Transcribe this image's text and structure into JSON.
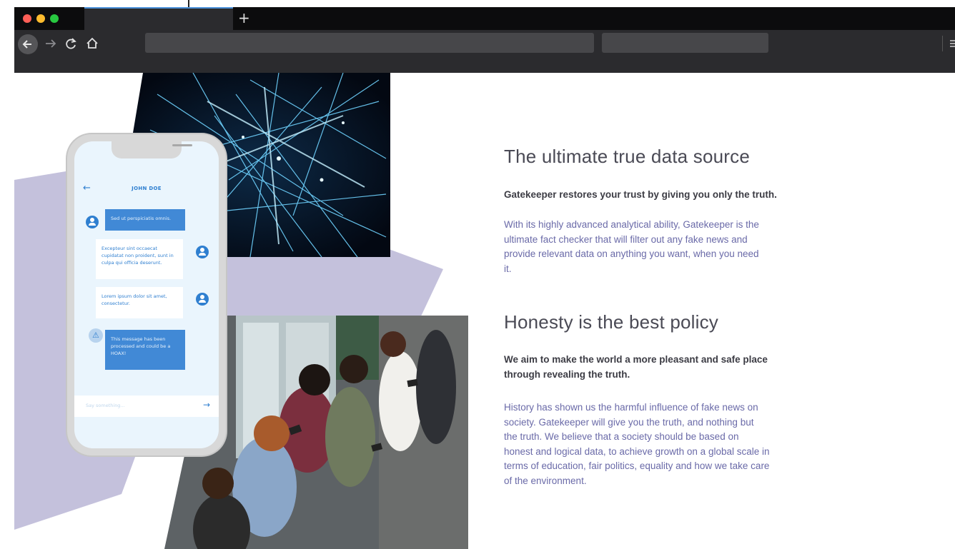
{
  "browser": {
    "new_tab_label": "+",
    "back_icon": "back-arrow-icon",
    "forward_icon": "forward-arrow-icon",
    "reload_icon": "reload-icon",
    "home_icon": "home-icon",
    "traffic_lights": [
      "#ff5f57",
      "#febc2e",
      "#28c840"
    ]
  },
  "phone": {
    "chat_title": "JOHN DOE",
    "messages": [
      {
        "side": "in",
        "text": "Sed ut perspiciatis omnis."
      },
      {
        "side": "out",
        "text": "Excepteur sint occaecat cupidatat non proident, sunt in culpa qui officia deserunt."
      },
      {
        "side": "out",
        "text": "Lorem ipsum dolor sit amet, consectetur."
      },
      {
        "side": "in",
        "text": "This message has been processed and could be a HOAX!"
      }
    ],
    "input_placeholder": "Say something...",
    "accent": "#2f7fd0"
  },
  "section1": {
    "heading": "The ultimate true data source",
    "lead": "Gatekeeper restores your trust by giving you only the truth.",
    "body_lines": [
      "With its highly advanced analytical ability, Gatekeeper is the",
      "ultimate fact checker that will filter out any fake news and",
      "provide relevant data on anything you want, when you need",
      "it."
    ]
  },
  "section2": {
    "heading": "Honesty is the best policy",
    "lead_lines": [
      "We aim to make the world a more pleasant and safe place",
      "through revealing the truth."
    ],
    "body_lines": [
      "History has shown us the harmful influence of fake news on",
      "society. Gatekeeper will give you the truth, and nothing but",
      "the truth. We believe that a society should be based on",
      "honest and logical data, to achieve growth on a global scale in",
      "terms of education, fair politics, equality and how we take care",
      "of the environment."
    ]
  },
  "colors": {
    "accent_purple": "#c4c1dc",
    "body_text": "#6a6aa8",
    "heading_text": "#4a4a55"
  }
}
